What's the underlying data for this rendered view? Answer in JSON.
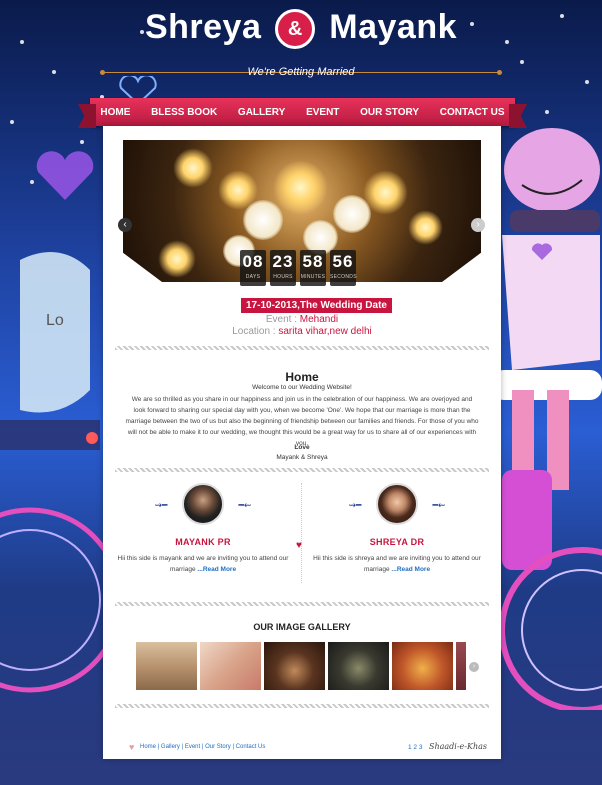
{
  "header": {
    "name_left": "Shreya",
    "amp": "&",
    "name_right": "Mayank",
    "tagline": "We're Getting Married"
  },
  "nav": {
    "items": [
      "HOME",
      "BLESS BOOK",
      "GALLERY",
      "EVENT",
      "OUR STORY",
      "CONTACT US"
    ]
  },
  "slider": {
    "countdown": [
      {
        "value": "08",
        "label": "DAYS"
      },
      {
        "value": "23",
        "label": "HOURS"
      },
      {
        "value": "58",
        "label": "MINUTES"
      },
      {
        "value": "56",
        "label": "SECONDS"
      }
    ]
  },
  "event_info": {
    "date_badge": "17-10-2013,The Wedding Date",
    "event_label": "Event :",
    "event_value": "Mehandi",
    "location_label": "Location :",
    "location_value": "sarita vihar,new delhi"
  },
  "home": {
    "title": "Home",
    "welcome": "Welcome to our Wedding Website!",
    "paragraph": "We are so thrilled as you share in our happiness and join us in the celebration of our happiness. We are overjoyed and look forward to sharing our special day with you, when we become 'One'. We hope that our marriage is more than the marriage between the two of us but also the beginning of friendship between our families and friends. For those of you who will not be able to make it to our wedding, we thought this would be a great way for us to share all of our experiences with you.",
    "sign_title": "Love",
    "sign_names": "Mayank & Shreya"
  },
  "couple": {
    "groom": {
      "name": "MAYANK PR",
      "text": "Hii this side is mayank and we are inviting you to attend our marriage",
      "read_more": "...Read More"
    },
    "bride": {
      "name": "SHREYA DR",
      "text": "Hii this side is shreya and we are inviting you to attend our marriage",
      "read_more": "...Read More"
    }
  },
  "gallery": {
    "title": "OUR IMAGE GALLERY",
    "colors": [
      "#b9936f",
      "#d9a48a",
      "#3a2418",
      "#2a2a2a",
      "#c0572a",
      "#6a2a30"
    ]
  },
  "footer": {
    "links": [
      "Home",
      "Gallery",
      "Event",
      "Our Story",
      "Contact Us"
    ],
    "pages": "1 2 3",
    "signature": "Shaadi-e-Khas"
  },
  "colors": {
    "accent": "#c8153f",
    "link": "#1f6fbf",
    "navy_orn": "#1f3a8f"
  }
}
